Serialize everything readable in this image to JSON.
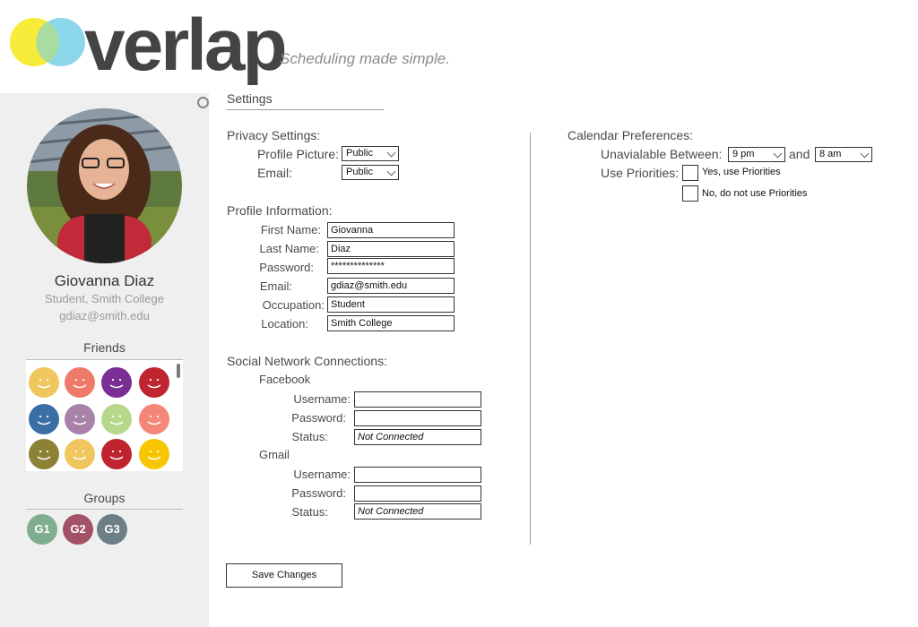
{
  "brand": {
    "wordmark": "verlap",
    "tagline": "Scheduling made simple.",
    "colors": {
      "yellow": "#f7ec3a",
      "blue": "#7fd3e8",
      "dark": "#444444"
    }
  },
  "sidebar": {
    "user": {
      "name": "Giovanna Diaz",
      "role": "Student, Smith College",
      "email": "gdiaz@smith.edu"
    },
    "friends_title": "Friends",
    "friends": [
      {
        "color": "#f0c75e"
      },
      {
        "color": "#f07a6a"
      },
      {
        "color": "#7b2f94"
      },
      {
        "color": "#c0242f"
      },
      {
        "color": "#3a6ea5"
      },
      {
        "color": "#a882a8"
      },
      {
        "color": "#b7d88a"
      },
      {
        "color": "#f4877a"
      },
      {
        "color": "#8c8236"
      },
      {
        "color": "#f0c75e"
      },
      {
        "color": "#c0242f"
      },
      {
        "color": "#f7c600"
      }
    ],
    "groups_title": "Groups",
    "groups": [
      {
        "label": "G1",
        "color": "#7fae8e"
      },
      {
        "label": "G2",
        "color": "#a35266"
      },
      {
        "label": "G3",
        "color": "#6b7f86"
      }
    ]
  },
  "settings": {
    "title": "Settings",
    "privacy": {
      "heading": "Privacy Settings:",
      "profile_picture_label": "Profile Picture:",
      "profile_picture_value": "Public",
      "email_label": "Email:",
      "email_value": "Public"
    },
    "profile": {
      "heading": "Profile Information:",
      "first_name_label": "First Name:",
      "first_name": "Giovanna",
      "last_name_label": "Last Name:",
      "last_name": "Diaz",
      "password_label": "Password:",
      "password": "**************",
      "email_label": "Email:",
      "email": "gdiaz@smith.edu",
      "occupation_label": "Occupation:",
      "occupation": "Student",
      "location_label": "Location:",
      "location": "Smith College"
    },
    "social": {
      "heading": "Social Network Connections:",
      "facebook": {
        "title": "Facebook",
        "username_label": "Username:",
        "password_label": "Password:",
        "status_label": "Status:",
        "status": "Not Connected"
      },
      "gmail": {
        "title": "Gmail",
        "username_label": "Username:",
        "password_label": "Password:",
        "status_label": "Status:",
        "status": "Not Connected"
      }
    },
    "calendar": {
      "heading": "Calendar Preferences:",
      "unavailable_label": "Unavialable Between:",
      "from": "9 pm",
      "and_label": "and",
      "to": "8 am",
      "priorities_label": "Use Priorities:",
      "option_yes": "Yes, use Priorities",
      "option_no": "No, do not use Priorities"
    },
    "save_label": "Save Changes"
  }
}
